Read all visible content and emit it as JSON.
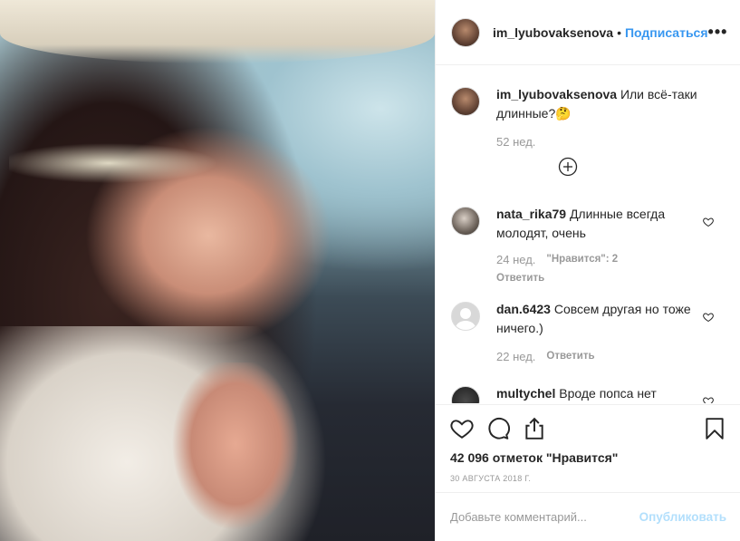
{
  "post": {
    "username": "im_lyubovaksenova",
    "separator": "•",
    "follow_label": "Подписаться",
    "more_label": "•••"
  },
  "caption": {
    "username": "im_lyubovaksenova",
    "text": "Или всё-таки длинные?🤔",
    "age": "52 нед."
  },
  "comments": [
    {
      "username": "nata_rika79",
      "text": "Длинные всегда молодят, очень",
      "age": "24 нед.",
      "likes": "\"Нравится\": 2",
      "reply": "Ответить"
    },
    {
      "username": "dan.6423",
      "text": "Совсем другая но тоже ничего.)",
      "age": "22 нед.",
      "reply": "Ответить"
    },
    {
      "username": "multychel",
      "text": "Вроде попса нет"
    }
  ],
  "likes_line": "42 096 отметок \"Нравится\"",
  "date": "30 августа 2018 г.",
  "add_comment": {
    "placeholder": "Добавьте комментарий...",
    "post_label": "Опубликовать"
  },
  "icons": {
    "like": "heart-icon",
    "comment": "comment-icon",
    "share": "share-icon",
    "save": "bookmark-icon",
    "load_more": "plus-circle-icon"
  },
  "colors": {
    "accent": "#3897f0",
    "post_disabled": "#b2dffc",
    "muted": "#999999"
  }
}
